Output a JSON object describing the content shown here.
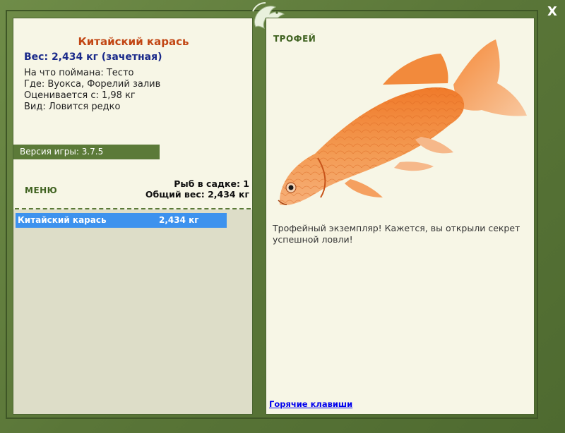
{
  "fish": {
    "title": "Китайский карась",
    "weight_line": "Вес: 2,434 кг (зачетная)",
    "caught_on": "На что поймана: Тесто",
    "where": "Где: Вуокса, Форелий залив",
    "rated_from": "Оценивается с: 1,98 кг",
    "kind": "Вид: Ловится редко"
  },
  "version": "Версия игры: 3.7.5",
  "menu_label": "МЕНЮ",
  "cage": {
    "count": "Рыб в садке: 1",
    "total_weight": "Общий вес: 2,434 кг"
  },
  "list": [
    {
      "name": "Китайский карась",
      "weight": "2,434 кг"
    }
  ],
  "trophy": {
    "label": "ТРОФЕЙ",
    "text": "Трофейный экземпляр! Кажется, вы открыли секрет успешной ловли!"
  },
  "hotkeys": "Горячие клавиши",
  "close": "X",
  "colors": {
    "frame": "#5e7a3c",
    "panel": "#f7f6e6",
    "accent_title": "#c24614",
    "weight": "#1a2a8a",
    "selection": "#3d92ee"
  },
  "icons": {
    "logo": "fish-logo-icon",
    "close": "close-icon"
  }
}
